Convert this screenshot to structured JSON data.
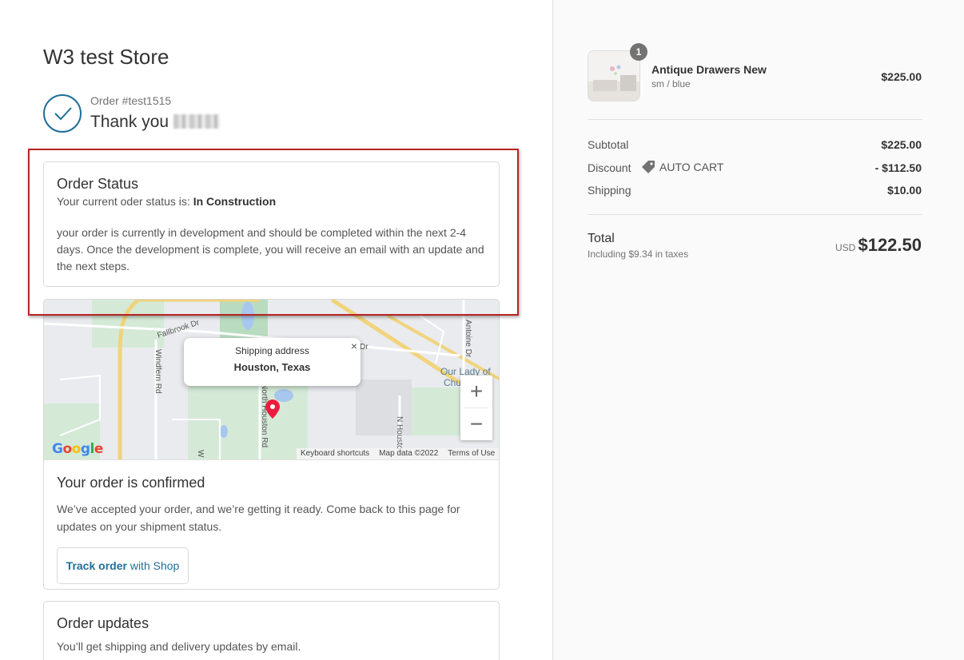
{
  "store": {
    "title": "W3 test Store"
  },
  "order": {
    "number": "Order #test1515",
    "thank_you": "Thank you"
  },
  "status": {
    "title": "Order Status",
    "line_prefix": "Your current oder status is: ",
    "current": "In Construction",
    "description": "your order is currently in development and should be completed within the next 2-4 days. Once the development is complete, you will receive an email with an update and the next steps."
  },
  "map": {
    "popup_title": "Shipping address",
    "popup_city": "Houston, Texas",
    "close": "×",
    "zoom_in": "+",
    "zoom_out": "−",
    "logo": "Google",
    "footer": [
      "Keyboard shortcuts",
      "Map data ©2022",
      "Terms of Use"
    ],
    "labels": {
      "fallbrook": "Fallbrook Dr",
      "windfern": "Windfern Rd",
      "north_houston": "North Houston Rd",
      "n_houston": "N Houston",
      "antoine": "Antoine Dr",
      "our_lady_1": "Our Lady of",
      "our_lady_2": "Chu",
      "dr": "Dr",
      "w": "W"
    }
  },
  "confirmation": {
    "title": "Your order is confirmed",
    "description": "We’ve accepted your order, and we’re getting it ready. Come back to this page for updates on your shipment status.",
    "track_bold": "Track order",
    "track_rest": " with Shop"
  },
  "updates": {
    "title": "Order updates",
    "description": "You’ll get shipping and delivery updates by email."
  },
  "cart": {
    "product": {
      "name": "Antique Drawers New",
      "variant": "sm / blue",
      "price": "$225.00",
      "quantity": "1"
    },
    "subtotal_label": "Subtotal",
    "subtotal_value": "$225.00",
    "discount_label": "Discount",
    "discount_code": "AUTO CART",
    "discount_value": "- $112.50",
    "shipping_label": "Shipping",
    "shipping_value": "$10.00",
    "total_label": "Total",
    "tax_note": "Including $9.34 in taxes",
    "currency": "USD",
    "total_value": "$122.50"
  },
  "colors": {
    "accent": "#1f6f9a",
    "highlight": "#b82424",
    "pin": "#ea1d3d"
  }
}
